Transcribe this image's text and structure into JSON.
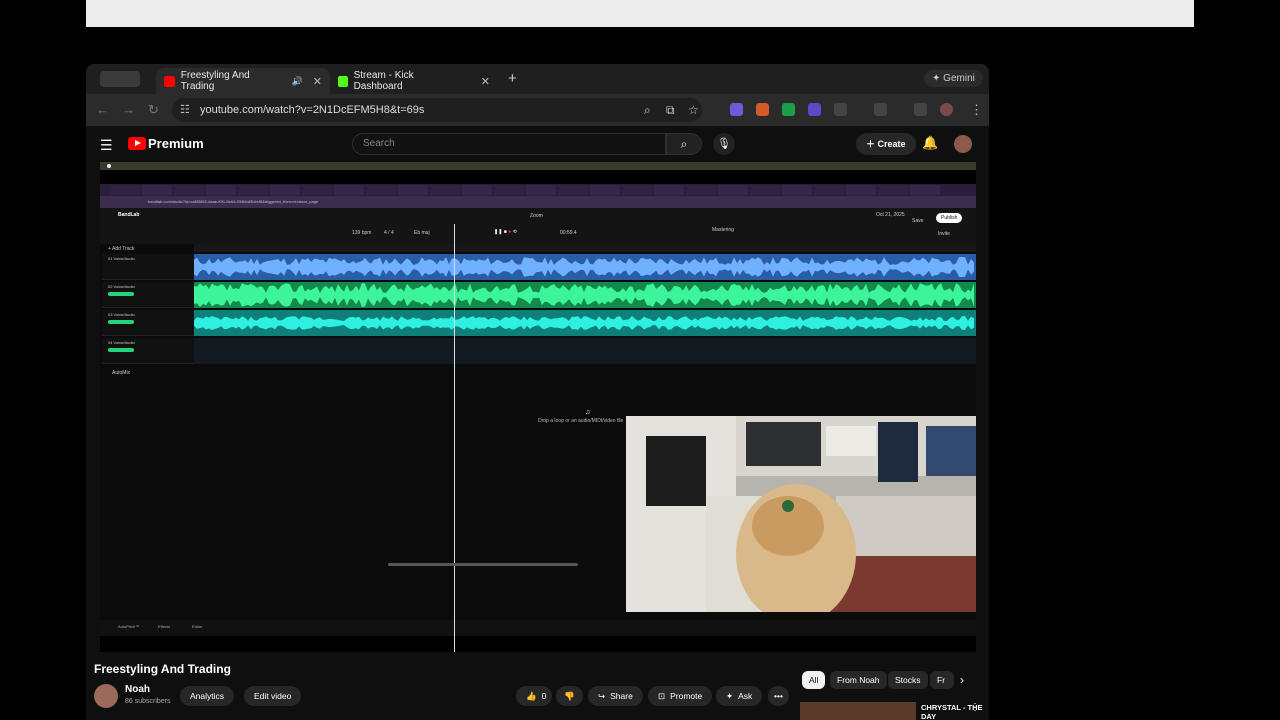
{
  "os": {
    "apple_glyph": ""
  },
  "browser": {
    "tabs": [
      {
        "title": "Freestyling And Trading",
        "active": true,
        "favicon_color": "#ff0000"
      },
      {
        "title": "Stream - Kick Dashboard",
        "active": false,
        "favicon_color": "#53fc18"
      }
    ],
    "new_tab": "+",
    "gemini_label": "Gemini",
    "url": "youtube.com/watch?v=2N1DcEFM5H8&t=69s"
  },
  "youtube": {
    "brand": "Premium",
    "search_placeholder": "Search",
    "create_label": "Create",
    "video_title": "Freestyling And Trading",
    "channel_name": "Noah",
    "subscribers": "86 subscribers",
    "analytics_label": "Analytics",
    "edit_video_label": "Edit video",
    "like_count": "0",
    "share_label": "Share",
    "promote_label": "Promote",
    "ask_label": "Ask",
    "chips": [
      "All",
      "From Noah",
      "Stocks",
      "Fr"
    ],
    "recommended_title": "CHRYSTAL - THE DAY"
  },
  "video_content": {
    "daw_app": "BandLab",
    "daw_url": "bandlab.com/studio?id=ca6f3862-daae-f0f1-8e64-934bbd3b4ef8&triggered_from=revision_page",
    "zoom_label": "Zoom",
    "time": "00:59.4",
    "bpm": "139 bpm",
    "signature": "4 / 4",
    "key": "Eb maj",
    "save_label": "Save",
    "publish_label": "Publish",
    "invite_label": "Invite",
    "date": "Oct 21, 2025",
    "mastering_label": "Mastering",
    "add_track": "+ Add Track",
    "automix": "AutoMix",
    "drop_hint": "Drop a loop or an audio/MIDI/video file",
    "footer_tabs": [
      "AutoPitch™",
      "Effects",
      "Editor"
    ],
    "tracks": [
      {
        "name": "01 Voice/Audio",
        "color": "#3a8ee6"
      },
      {
        "name": "02 Voice/Audio",
        "color": "#22d47a"
      },
      {
        "name": "03 Voice/Audio",
        "color": "#19d6c6"
      },
      {
        "name": "04 Voice/Audio",
        "color": "#22d47a"
      }
    ]
  }
}
